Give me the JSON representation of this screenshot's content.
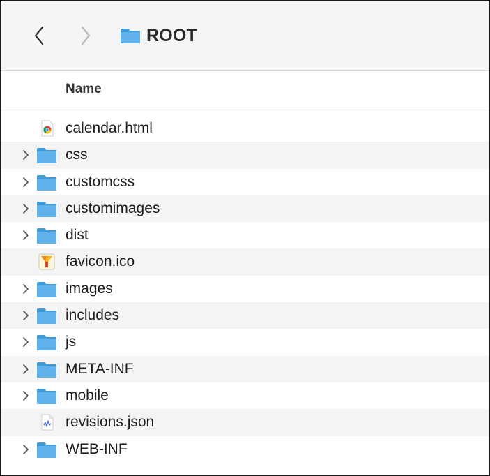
{
  "toolbar": {
    "title": "ROOT",
    "back_icon": "chevron-left-icon",
    "forward_icon": "chevron-right-icon",
    "folder_icon": "folder-icon"
  },
  "columns": {
    "name": "Name"
  },
  "colors": {
    "folder": "#5fb3ea",
    "folder_dark": "#3f9ad6",
    "stripe": "#f4f4f4",
    "toolbar_bg": "#f6f5f5"
  },
  "files": [
    {
      "name": "calendar.html",
      "kind": "file",
      "icon": "chrome-html-icon"
    },
    {
      "name": "css",
      "kind": "folder",
      "icon": "folder-icon"
    },
    {
      "name": "customcss",
      "kind": "folder",
      "icon": "folder-icon"
    },
    {
      "name": "customimages",
      "kind": "folder",
      "icon": "folder-icon"
    },
    {
      "name": "dist",
      "kind": "folder",
      "icon": "folder-icon"
    },
    {
      "name": "favicon.ico",
      "kind": "file",
      "icon": "favicon-icon"
    },
    {
      "name": "images",
      "kind": "folder",
      "icon": "folder-icon"
    },
    {
      "name": "includes",
      "kind": "folder",
      "icon": "folder-icon"
    },
    {
      "name": "js",
      "kind": "folder",
      "icon": "folder-icon"
    },
    {
      "name": "META-INF",
      "kind": "folder",
      "icon": "folder-icon"
    },
    {
      "name": "mobile",
      "kind": "folder",
      "icon": "folder-icon"
    },
    {
      "name": "revisions.json",
      "kind": "file",
      "icon": "json-file-icon"
    },
    {
      "name": "WEB-INF",
      "kind": "folder",
      "icon": "folder-icon"
    }
  ]
}
